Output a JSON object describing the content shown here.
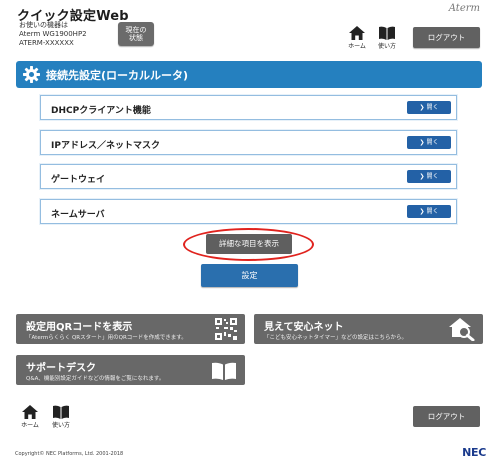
{
  "header": {
    "app_title": "クイック設定Web",
    "device_caption": "お使いの機器は",
    "device_model": "Aterm WG1900HP2",
    "device_id": "ATERM-XXXXXX",
    "status_button": [
      "現在の",
      "状態"
    ],
    "brand": "Aterm",
    "home_label": "ホーム",
    "help_label": "使い方",
    "logout_label": "ログアウト"
  },
  "section": {
    "title": "接続先設定(ローカルルータ)"
  },
  "rows": [
    {
      "label": "DHCPクライアント機能",
      "button": "開く"
    },
    {
      "label": "IPアドレス／ネットマスク",
      "button": "開く"
    },
    {
      "label": "ゲートウェイ",
      "button": "開く"
    },
    {
      "label": "ネームサーバ",
      "button": "開く"
    }
  ],
  "actions": {
    "show_details": "詳細な項目を表示",
    "apply": "設定"
  },
  "panels": {
    "qr": {
      "title": "設定用QRコードを表示",
      "desc": "「Atermらくらく QRスタート」用のQRコードを作成できます。"
    },
    "safety": {
      "title": "見えて安心ネット",
      "desc": "「こども安心ネットタイマー」などの設定はこちらから。"
    },
    "support": {
      "title": "サポートデスク",
      "desc": "Q&A、機能別設定ガイドなどの情報をご覧になれます。"
    }
  },
  "footer": {
    "home_label": "ホーム",
    "help_label": "使い方",
    "logout_label": "ログアウト",
    "copyright": "Copyright© NEC Platforms, Ltd. 2001-2018",
    "logo": "NEC"
  },
  "colors": {
    "accent_blue": "#2580bf",
    "button_blue": "#2361a6",
    "highlight_red": "#e0231e",
    "panel_gray": "#686868"
  }
}
